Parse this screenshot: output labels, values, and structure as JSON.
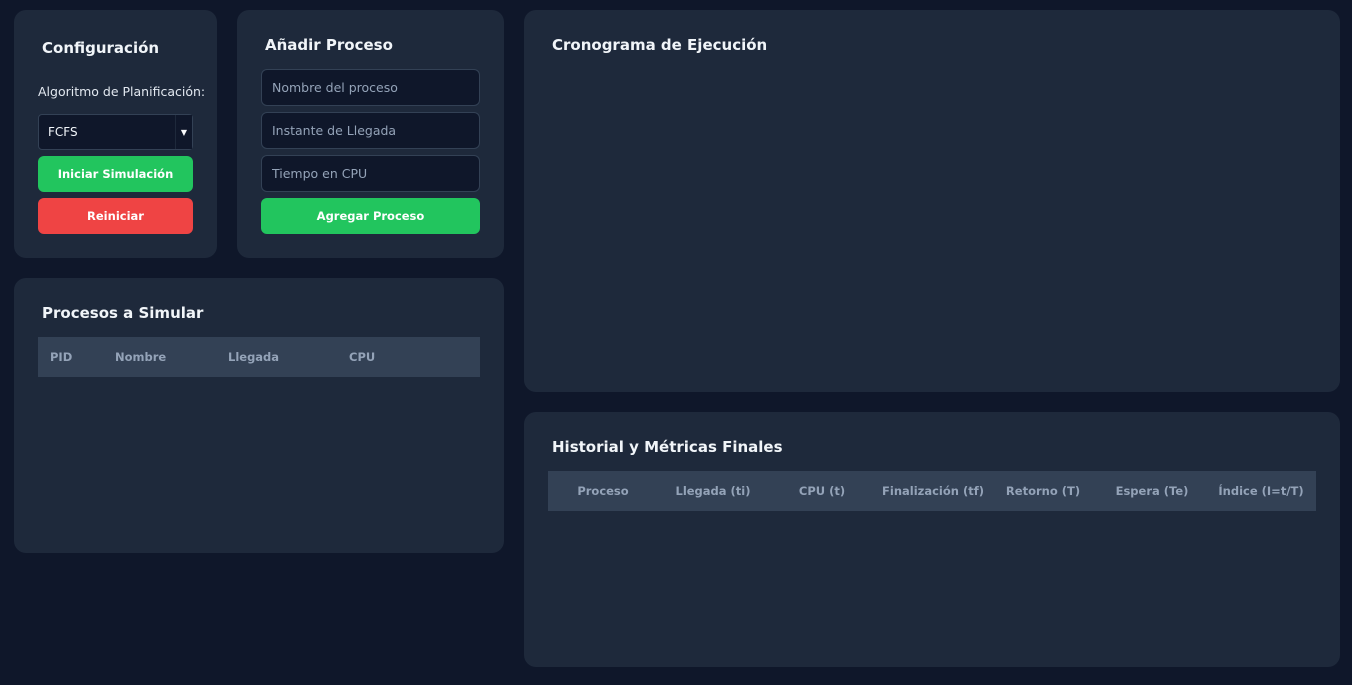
{
  "config": {
    "title": "Configuración",
    "algorithm_label": "Algoritmo de Planificación:",
    "algorithm_selected": "FCFS",
    "start_label": "Iniciar Simulación",
    "reset_label": "Reiniciar"
  },
  "add_process": {
    "title": "Añadir Proceso",
    "name_placeholder": "Nombre del proceso",
    "name_value": "",
    "arrival_placeholder": "Instante de Llegada",
    "arrival_value": "",
    "cpu_placeholder": "Tiempo en CPU",
    "cpu_value": "",
    "add_label": "Agregar Proceso"
  },
  "processes": {
    "title": "Procesos a Simular",
    "columns": [
      "PID",
      "Nombre",
      "Llegada",
      "CPU"
    ],
    "rows": []
  },
  "timeline": {
    "title": "Cronograma de Ejecución"
  },
  "history": {
    "title": "Historial y Métricas Finales",
    "columns": [
      "Proceso",
      "Llegada (ti)",
      "CPU (t)",
      "Finalización (tf)",
      "Retorno (T)",
      "Espera (Te)",
      "Índice (I=t/T)"
    ],
    "rows": []
  },
  "colors": {
    "background": "#0f172a",
    "card": "#1e293b",
    "accent_green": "#22c55e",
    "accent_red": "#ef4444",
    "table_header": "#334155"
  }
}
